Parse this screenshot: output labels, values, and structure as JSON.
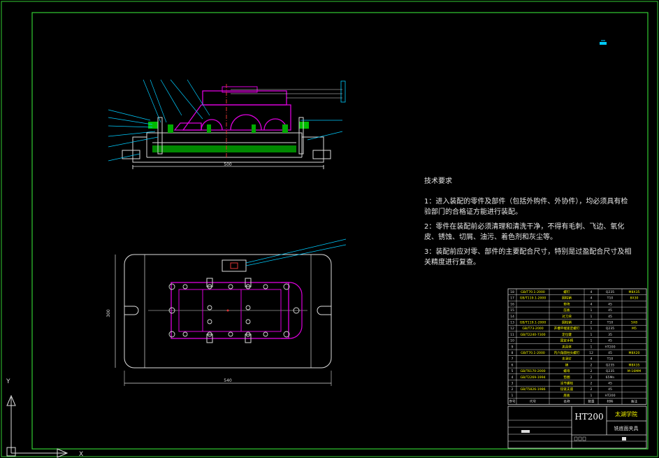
{
  "drawing": {
    "material": "HT200",
    "school": "太湖学院",
    "part_name": "铣底面夹具",
    "dimensions": {
      "front_width": "500",
      "plan_width": "540",
      "plan_height": "300"
    }
  },
  "technical_requirements": {
    "title": "技术要求",
    "items": [
      "1：进入装配的零件及部件（包括外购件、外协件），均必须具有检验部门的合格证方能进行装配。",
      "2：零件在装配前必须清理和清洗干净，不得有毛刺、飞边、氧化皮、锈蚀、切屑、油污、着色剂和灰尘等。",
      "3：装配前应对零、部件的主要配合尺寸，特别是过盈配合尺寸及相关精度进行复查。"
    ]
  },
  "bom": {
    "rows": [
      {
        "no": "18",
        "std": "GB/T70.1-2000",
        "name": "螺钉",
        "qty": "4",
        "mat": "Q235",
        "note": "M8X35"
      },
      {
        "no": "17",
        "std": "GB/T119.1-2000",
        "name": "圆柱销",
        "qty": "4",
        "mat": "T10",
        "note": "8X30"
      },
      {
        "no": "16",
        "std": "",
        "name": "垫块",
        "qty": "4",
        "mat": "45",
        "note": ""
      },
      {
        "no": "15",
        "std": "",
        "name": "压板",
        "qty": "1",
        "mat": "45",
        "note": ""
      },
      {
        "no": "14",
        "std": "",
        "name": "对刀块",
        "qty": "1",
        "mat": "45",
        "note": ""
      },
      {
        "no": "13",
        "std": "GB/T119.1-2000",
        "name": "圆柱销",
        "qty": "2",
        "mat": "T10",
        "note": "5X8"
      },
      {
        "no": "12",
        "std": "GB/T73-2000",
        "name": "开槽平端紧定螺钉",
        "qty": "1",
        "mat": "Q235",
        "note": "M5"
      },
      {
        "no": "11",
        "std": "GB/T2240-7300",
        "name": "定位键",
        "qty": "1",
        "mat": "35",
        "note": ""
      },
      {
        "no": "10",
        "std": "",
        "name": "固定手柄",
        "qty": "1",
        "mat": "45",
        "note": ""
      },
      {
        "no": "9",
        "std": "",
        "name": "夹具体",
        "qty": "1",
        "mat": "HT200",
        "note": ""
      },
      {
        "no": "8",
        "std": "GB/T70.1-2000",
        "name": "内六角圆柱头螺钉",
        "qty": "12",
        "mat": "45",
        "note": "M8X20"
      },
      {
        "no": "7",
        "std": "",
        "name": "支承钉",
        "qty": "4",
        "mat": "T10",
        "note": ""
      },
      {
        "no": "6",
        "std": "",
        "name": "销",
        "qty": "2",
        "mat": "Q235",
        "note": "M8X35"
      },
      {
        "no": "5",
        "std": "GB/T6170-2000",
        "name": "螺母",
        "qty": "2",
        "mat": "Q235",
        "note": "M-16MM"
      },
      {
        "no": "4",
        "std": "GB/T2269-1994",
        "name": "垫圈",
        "qty": "2",
        "mat": "65Mn",
        "note": ""
      },
      {
        "no": "3",
        "std": "",
        "name": "活节螺栓",
        "qty": "2",
        "mat": "45",
        "note": ""
      },
      {
        "no": "2",
        "std": "GB/T5826-1986",
        "name": "铰链支座",
        "qty": "2",
        "mat": "45",
        "note": ""
      },
      {
        "no": "1",
        "std": "",
        "name": "底板",
        "qty": "1",
        "mat": "HT200",
        "note": ""
      }
    ],
    "header": {
      "no": "序号",
      "code": "代号",
      "name": "名称",
      "qty": "数量",
      "mat": "材料",
      "note": "备注"
    }
  }
}
